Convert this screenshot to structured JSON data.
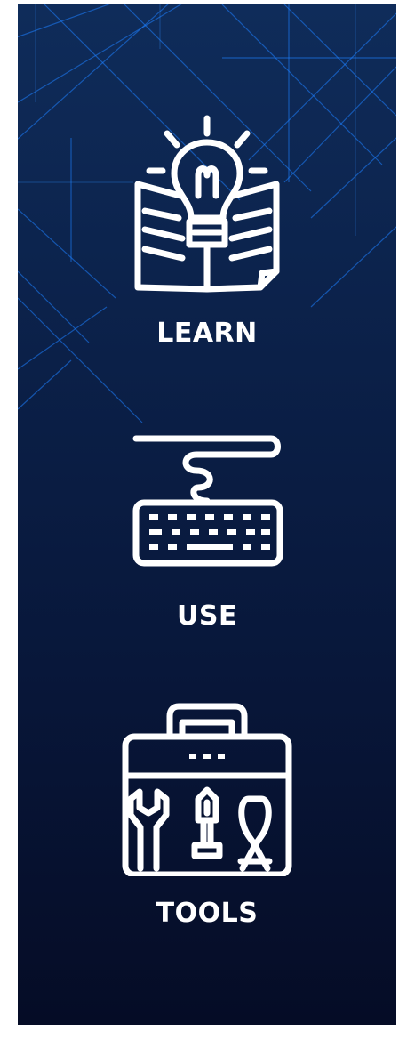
{
  "banner": {
    "background_colors": [
      "#0f2c5a",
      "#050c26"
    ],
    "line_color": "#1d7fff",
    "items": [
      {
        "label": "LEARN",
        "icon": "lightbulb-book-icon"
      },
      {
        "label": "USE",
        "icon": "keyboard-icon"
      },
      {
        "label": "TOOLS",
        "icon": "toolbox-icon"
      }
    ]
  }
}
